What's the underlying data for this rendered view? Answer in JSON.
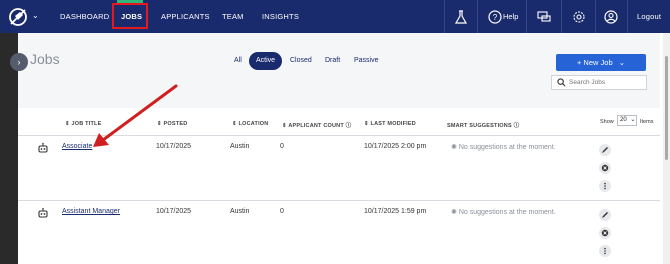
{
  "nav": {
    "items": [
      "DASHBOARD",
      "JOBS",
      "APPLICANTS",
      "TEAM",
      "INSIGHTS"
    ],
    "help_label": "Help",
    "logout_label": "Logout",
    "icons": [
      "flask-icon",
      "help-circle-icon",
      "chat-icon",
      "gear-icon",
      "user-circle-icon"
    ]
  },
  "page": {
    "title": "Jobs"
  },
  "filters": [
    "All",
    "Active",
    "Closed",
    "Draft",
    "Passive"
  ],
  "active_filter": "Active",
  "new_job_label": "+ New Job",
  "search": {
    "placeholder": "Search Jobs"
  },
  "table": {
    "columns": [
      "JOB TITLE",
      "POSTED",
      "LOCATION",
      "APPLICANT COUNT",
      "LAST MODIFIED",
      "SMART SUGGESTIONS"
    ],
    "show_label": "Show",
    "page_size": "20",
    "items_label": "Items",
    "rows": [
      {
        "title": "Associate",
        "posted": "10/17/2025",
        "location": "Austin",
        "applicants": "0",
        "modified": "10/17/2025 2:00 pm",
        "suggestion": "No suggestions at the moment."
      },
      {
        "title": "Assistant Manager",
        "posted": "10/17/2025",
        "location": "Austin",
        "applicants": "0",
        "modified": "10/17/2025 1:59 pm",
        "suggestion": "No suggestions at the moment."
      }
    ]
  },
  "colors": {
    "nav_bg": "#1a2b6d",
    "highlight": "#e3191f",
    "primary": "#2563d6",
    "accent_green": "#2fb877",
    "annotation_arrow": "#d11f1f"
  }
}
